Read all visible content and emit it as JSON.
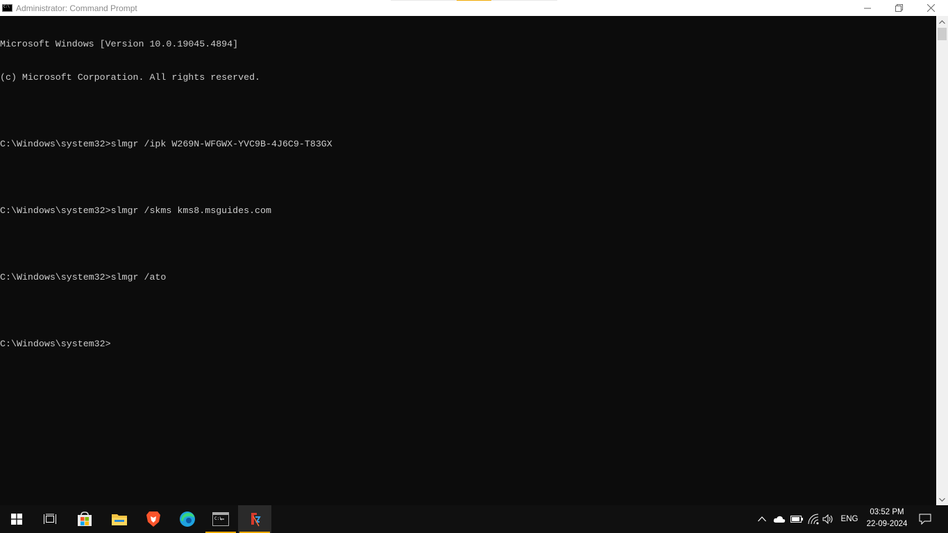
{
  "window": {
    "title": "Administrator: Command Prompt",
    "controls": {
      "minimize": "minimize",
      "restore": "restore",
      "close": "close"
    }
  },
  "console": {
    "lines": [
      "Microsoft Windows [Version 10.0.19045.4894]",
      "(c) Microsoft Corporation. All rights reserved.",
      "",
      "C:\\Windows\\system32>slmgr /ipk W269N-WFGWX-YVC9B-4J6C9-T83GX",
      "",
      "C:\\Windows\\system32>slmgr /skms kms8.msguides.com",
      "",
      "C:\\Windows\\system32>slmgr /ato",
      "",
      "C:\\Windows\\system32>"
    ]
  },
  "taskbar": {
    "pinned": [
      {
        "name": "start-icon"
      },
      {
        "name": "task-view-icon"
      },
      {
        "name": "microsoft-store-icon"
      },
      {
        "name": "file-explorer-icon"
      },
      {
        "name": "brave-browser-icon"
      },
      {
        "name": "edge-browser-icon"
      },
      {
        "name": "command-prompt-icon"
      },
      {
        "name": "app-icon"
      }
    ],
    "tray": {
      "language": "ENG",
      "time": "03:52 PM",
      "date": "22-09-2024"
    }
  },
  "colors": {
    "console_bg": "#0c0c0c",
    "console_fg": "#cccccc",
    "taskbar_bg": "#101010",
    "accent": "#f0a800"
  }
}
